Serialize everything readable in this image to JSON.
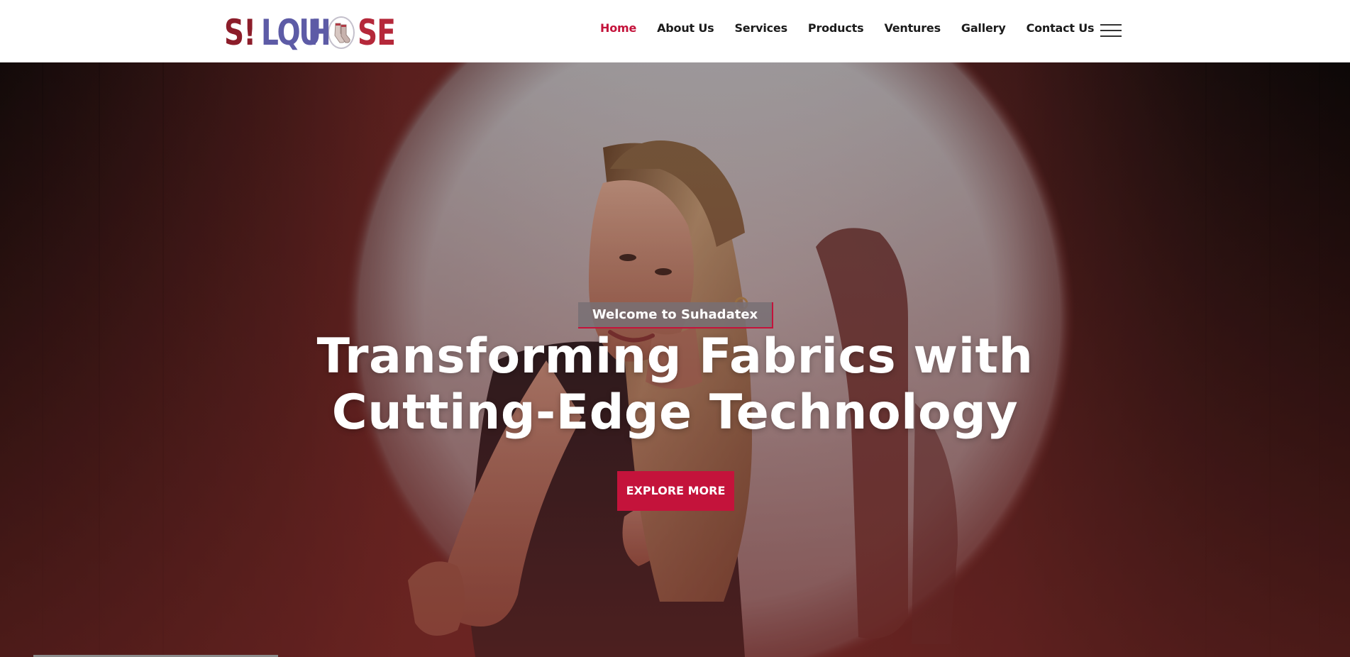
{
  "header": {
    "logo": {
      "seg1": "S!",
      "seg2": "LQU",
      "seg2b": "E",
      "seg3": "H",
      "seg4": "SE",
      "icon": "socks-icon"
    },
    "nav": [
      {
        "label": "Home",
        "active": true
      },
      {
        "label": "About Us",
        "active": false
      },
      {
        "label": "Services",
        "active": false
      },
      {
        "label": "Products",
        "active": false
      },
      {
        "label": "Ventures",
        "active": false
      },
      {
        "label": "Gallery",
        "active": false
      },
      {
        "label": "Contact Us",
        "active": false
      }
    ],
    "menu_icon": "hamburger-menu-icon"
  },
  "hero": {
    "eyebrow": "Welcome to Suhadatex",
    "headline_line1": "Transforming Fabrics with",
    "headline_line2": "Cutting-Edge Technology",
    "cta_label": "EXPLORE MORE"
  },
  "colors": {
    "accent": "#c4133b",
    "logo_red": "#8c1d2a",
    "logo_purple": "#5d5ba6",
    "hero_bg": "#6b2624"
  }
}
